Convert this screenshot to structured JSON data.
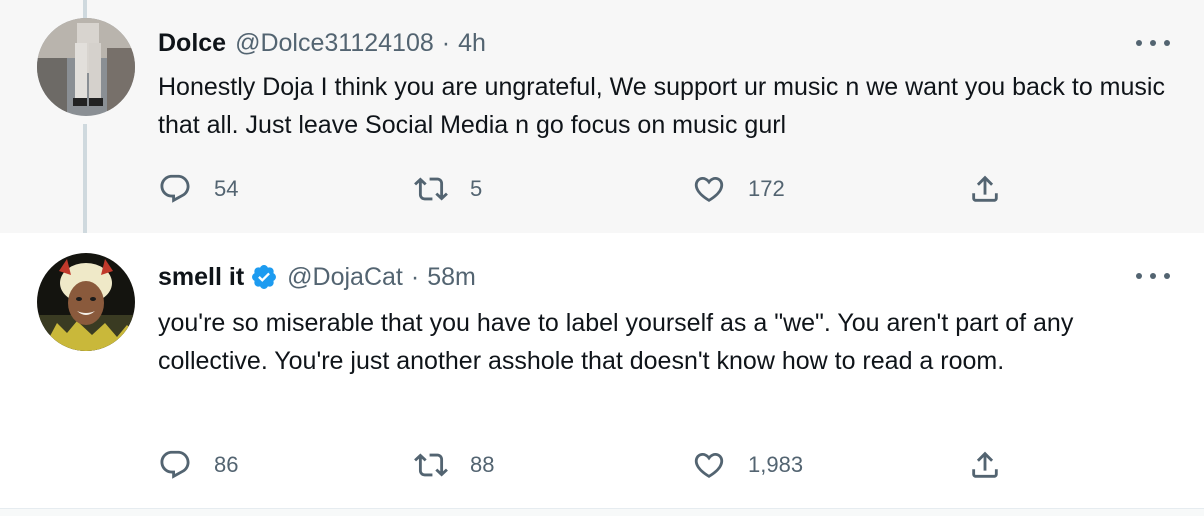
{
  "tweets": [
    {
      "display_name": "Dolce",
      "handle": "@Dolce31124108",
      "separator": "·",
      "time": "4h",
      "verified": false,
      "text": "Honestly Doja I think you are ungrateful, We support ur music n we want you back to music that all. Just leave Social Media n go focus on music gurl",
      "replies": "54",
      "retweets": "5",
      "likes": "172"
    },
    {
      "display_name": "smell it",
      "handle": "@DojaCat",
      "separator": "·",
      "time": "58m",
      "verified": true,
      "text": "you're so miserable that you have to label yourself as a \"we\". You aren't part of any collective. You're just another asshole that doesn't know how to read a room.",
      "replies": "86",
      "retweets": "88",
      "likes": "1,983"
    }
  ],
  "colors": {
    "thread_bg": "#f7f7f7",
    "secondary_text": "#536471",
    "verified_blue": "#1d9bf0",
    "thread_line": "#cfd9de"
  },
  "icons": [
    "reply-icon",
    "retweet-icon",
    "like-icon",
    "share-icon",
    "more-icon",
    "verified-badge-icon"
  ]
}
